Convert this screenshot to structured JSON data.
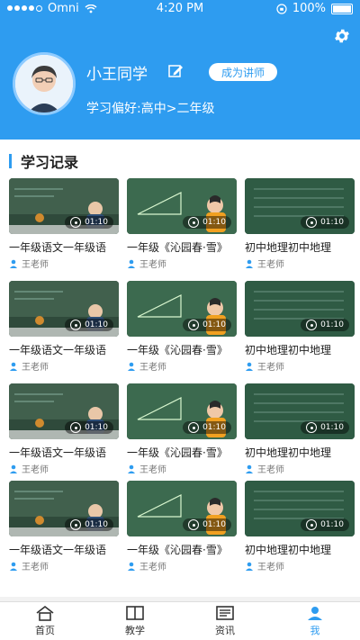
{
  "status": {
    "carrier": "Omni",
    "time": "4:20 PM",
    "battery": "100%"
  },
  "profile": {
    "name": "小王同学",
    "become_lecturer": "成为讲师",
    "preference": "学习偏好:高中>二年级"
  },
  "section": {
    "title": "学习记录"
  },
  "records": [
    [
      {
        "title": "一年级语文一年级语",
        "teacher": "王老师",
        "duration": "01:10",
        "thumb": "classroom"
      },
      {
        "title": "一年级《沁园春·雪》",
        "teacher": "王老师",
        "duration": "01:10",
        "thumb": "triangle"
      },
      {
        "title": "初中地理初中地理",
        "teacher": "王老师",
        "duration": "01:10",
        "thumb": "board"
      }
    ],
    [
      {
        "title": "一年级语文一年级语",
        "teacher": "王老师",
        "duration": "01:10",
        "thumb": "classroom"
      },
      {
        "title": "一年级《沁园春·雪》",
        "teacher": "王老师",
        "duration": "01:10",
        "thumb": "triangle"
      },
      {
        "title": "初中地理初中地理",
        "teacher": "王老师",
        "duration": "01:10",
        "thumb": "board"
      }
    ],
    [
      {
        "title": "一年级语文一年级语",
        "teacher": "王老师",
        "duration": "01:10",
        "thumb": "classroom"
      },
      {
        "title": "一年级《沁园春·雪》",
        "teacher": "王老师",
        "duration": "01:10",
        "thumb": "triangle"
      },
      {
        "title": "初中地理初中地理",
        "teacher": "王老师",
        "duration": "01:10",
        "thumb": "board"
      }
    ],
    [
      {
        "title": "一年级语文一年级语",
        "teacher": "王老师",
        "duration": "01:10",
        "thumb": "classroom"
      },
      {
        "title": "一年级《沁园春·雪》",
        "teacher": "王老师",
        "duration": "01:10",
        "thumb": "triangle"
      },
      {
        "title": "初中地理初中地理",
        "teacher": "王老师",
        "duration": "01:10",
        "thumb": "board"
      }
    ]
  ],
  "tabs": [
    {
      "label": "首页",
      "icon": "home-icon"
    },
    {
      "label": "教学",
      "icon": "book-icon"
    },
    {
      "label": "资讯",
      "icon": "news-icon"
    },
    {
      "label": "我",
      "icon": "user-icon"
    }
  ],
  "colors": {
    "primary": "#2e9cf0"
  }
}
